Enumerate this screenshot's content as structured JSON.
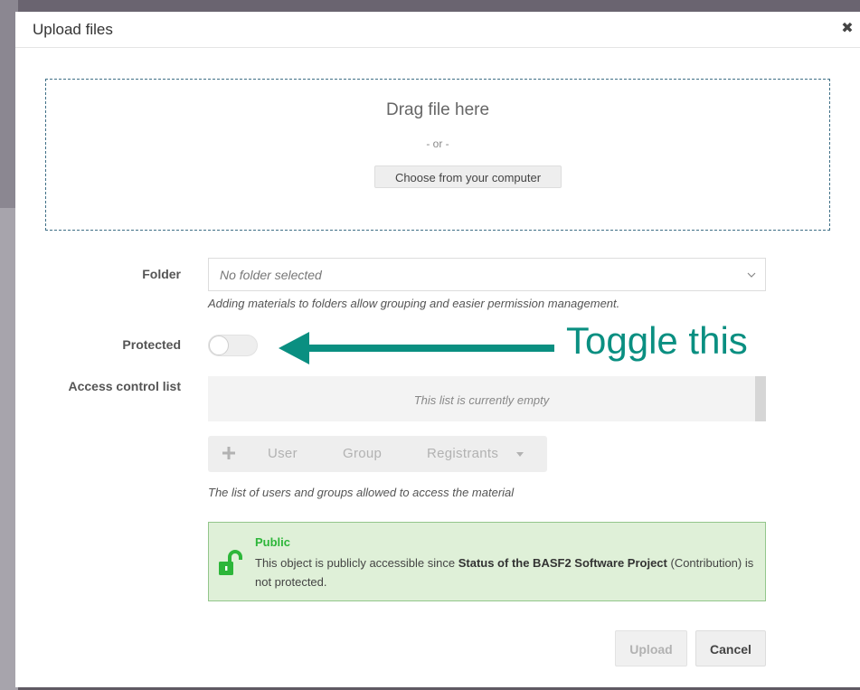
{
  "dialog": {
    "title": "Upload files",
    "close_icon": "close-icon"
  },
  "dropzone": {
    "title": "Drag file here",
    "or_text": "- or -",
    "choose_label": "Choose from your computer"
  },
  "folder": {
    "label": "Folder",
    "value": "No folder selected",
    "help": "Adding materials to folders allow grouping and easier permission management."
  },
  "protected": {
    "label": "Protected",
    "state": "off"
  },
  "annotation": {
    "text": "Toggle this",
    "color": "#0a8f81"
  },
  "acl": {
    "label": "Access control list",
    "empty_text": "This list is currently empty",
    "toolbar": {
      "add_icon": "plus-icon",
      "user": "User",
      "group": "Group",
      "registrants": "Registrants",
      "dropdown_icon": "caret-down-icon"
    },
    "help": "The list of users and groups allowed to access the material"
  },
  "public_notice": {
    "icon": "lock-open-icon",
    "title": "Public",
    "text_prefix": "This object is publicly accessible since ",
    "object_name": "Status of the BASF2 Software Project",
    "text_suffix": " (Contribution) is not protected.",
    "color": "#2db63a"
  },
  "buttons": {
    "upload": "Upload",
    "cancel": "Cancel"
  }
}
